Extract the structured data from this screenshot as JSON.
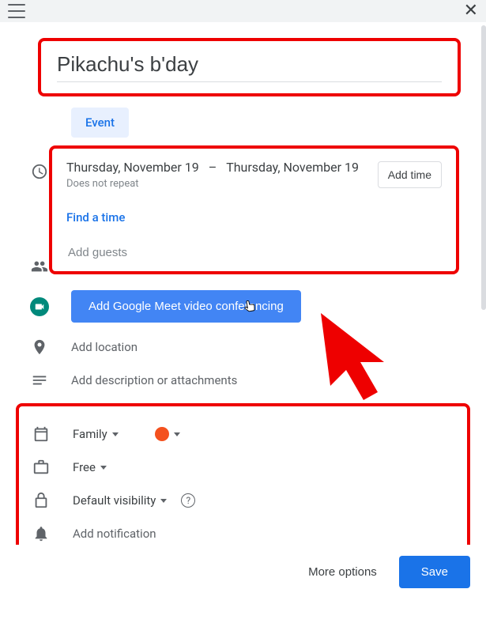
{
  "event": {
    "title": "Pikachu's b'day",
    "type_chip": "Event",
    "start_date": "Thursday, November 19",
    "date_separator": "–",
    "end_date": "Thursday, November 19",
    "repeat": "Does not repeat",
    "add_time": "Add time",
    "find_time": "Find a time",
    "guests_placeholder": "Add guests",
    "meet_button": "Add Google Meet video conferencing",
    "location_placeholder": "Add location",
    "description_placeholder": "Add description or attachments",
    "calendar_name": "Family",
    "color": "#f4511e",
    "availability": "Free",
    "visibility": "Default visibility",
    "notification_placeholder": "Add notification"
  },
  "footer": {
    "more_options": "More options",
    "save": "Save"
  }
}
